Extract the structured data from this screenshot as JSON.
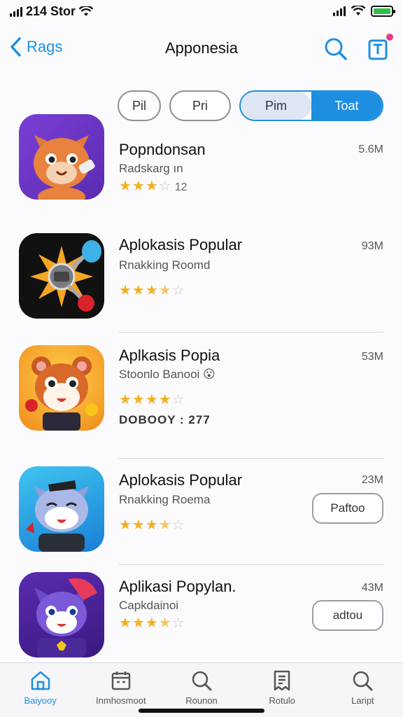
{
  "status": {
    "time": "214 Stor"
  },
  "nav": {
    "back_label": "Rags",
    "title": "Apponesia"
  },
  "filters": {
    "chip1": "Pil",
    "chip2": "Pri",
    "seg_a": "Pim",
    "seg_b": "Toat"
  },
  "apps": [
    {
      "name": "Popndonsan",
      "sub": "Radskarg ın",
      "rating_stars": 3,
      "rating_count": "12",
      "size": "5.6M",
      "icon": "orange-cat-icon"
    },
    {
      "name": "Aplokasis Popular",
      "sub": "Rnakking   Roomd",
      "rating_stars": 3.5,
      "size": "93M",
      "icon": "sun-robot-icon"
    },
    {
      "name": "Aplkasis Popia",
      "sub": "Stoonlo  Banooi 😮",
      "rating_stars": 4,
      "extra": "DOBOOY : 277",
      "size": "53M",
      "icon": "hamster-icon"
    },
    {
      "name": "Aplokasis Popular",
      "sub": "Rnakking  Roema",
      "rating_stars": 3.5,
      "size": "23M",
      "button": "Paftoo",
      "icon": "blue-cat-icon"
    },
    {
      "name": "Aplikasi Popylan.",
      "sub": "Capkdainoi",
      "rating_stars": 3.5,
      "size": "43M",
      "button": "adtou",
      "icon": "purple-cat-icon"
    }
  ],
  "tabs": [
    {
      "label": "Baiyooy",
      "icon": "home-icon",
      "active": true
    },
    {
      "label": "Inmhosmoot",
      "icon": "calendar-icon",
      "active": false
    },
    {
      "label": "Rounon",
      "icon": "search-icon",
      "active": false
    },
    {
      "label": "Rotulo",
      "icon": "document-icon",
      "active": false
    },
    {
      "label": "Laript",
      "icon": "search-icon",
      "active": false
    }
  ],
  "colors": {
    "accent": "#1e8fe0",
    "star": "#f2b01e"
  }
}
